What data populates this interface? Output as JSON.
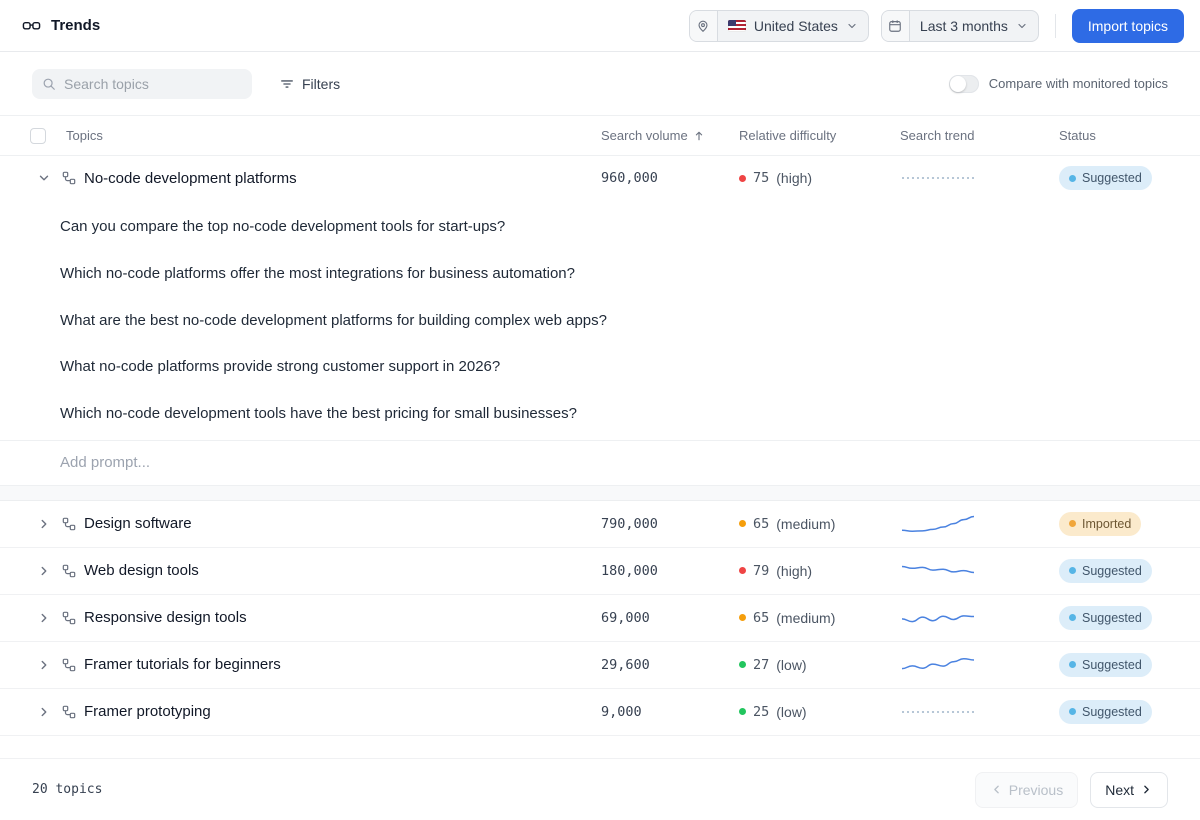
{
  "header": {
    "title": "Trends",
    "region": "United States",
    "date_range": "Last 3 months",
    "import_button": "Import topics"
  },
  "toolbar": {
    "search_placeholder": "Search topics",
    "filters": "Filters",
    "compare_label": "Compare with monitored topics"
  },
  "table": {
    "headers": {
      "topics": "Topics",
      "volume": "Search volume",
      "difficulty": "Relative difficulty",
      "trend": "Search trend",
      "status": "Status"
    },
    "rows": [
      {
        "name": "No-code development platforms",
        "volume": "960,000",
        "difficulty_num": "75",
        "difficulty_label": "(high)",
        "difficulty_color": "#ef4444",
        "status": "Suggested",
        "status_kind": "suggested",
        "trend": [
          0.5,
          0.5,
          0.5,
          0.5,
          0.5,
          0.5,
          0.5,
          0.5
        ],
        "trend_dashed": true
      },
      {
        "name": "Design software",
        "volume": "790,000",
        "difficulty_num": "65",
        "difficulty_label": "(medium)",
        "difficulty_color": "#f59e0b",
        "status": "Imported",
        "status_kind": "imported",
        "trend": [
          0.15,
          0.1,
          0.12,
          0.2,
          0.33,
          0.52,
          0.74,
          0.92
        ],
        "trend_dashed": false
      },
      {
        "name": "Web design tools",
        "volume": "180,000",
        "difficulty_num": "79",
        "difficulty_label": "(high)",
        "difficulty_color": "#ef4444",
        "status": "Suggested",
        "status_kind": "suggested",
        "trend": [
          0.75,
          0.65,
          0.7,
          0.55,
          0.6,
          0.45,
          0.52,
          0.42
        ],
        "trend_dashed": false
      },
      {
        "name": "Responsive design tools",
        "volume": "69,000",
        "difficulty_num": "65",
        "difficulty_label": "(medium)",
        "difficulty_color": "#f59e0b",
        "status": "Suggested",
        "status_kind": "suggested",
        "trend": [
          0.45,
          0.3,
          0.55,
          0.35,
          0.6,
          0.42,
          0.62,
          0.58
        ],
        "trend_dashed": false
      },
      {
        "name": "Framer tutorials for beginners",
        "volume": "29,600",
        "difficulty_num": "27",
        "difficulty_label": "(low)",
        "difficulty_color": "#22c55e",
        "status": "Suggested",
        "status_kind": "suggested",
        "trend": [
          0.3,
          0.45,
          0.32,
          0.55,
          0.44,
          0.68,
          0.85,
          0.78
        ],
        "trend_dashed": false
      },
      {
        "name": "Framer prototyping",
        "volume": "9,000",
        "difficulty_num": "25",
        "difficulty_label": "(low)",
        "difficulty_color": "#22c55e",
        "status": "Suggested",
        "status_kind": "suggested",
        "trend": [
          0.5,
          0.5,
          0.5,
          0.5,
          0.5,
          0.5,
          0.5,
          0.5
        ],
        "trend_dashed": true
      }
    ]
  },
  "expanded": {
    "prompts": [
      "Can you compare the top no-code development tools for start-ups?",
      "Which no-code platforms offer the most integrations for business automation?",
      "What are the best no-code development platforms for building complex web apps?",
      "What no-code platforms provide strong customer support in 2026?",
      "Which no-code development tools have the best pricing for small businesses?"
    ],
    "add_prompt_placeholder": "Add prompt..."
  },
  "footer": {
    "count": "20 topics",
    "previous": "Previous",
    "next": "Next"
  }
}
